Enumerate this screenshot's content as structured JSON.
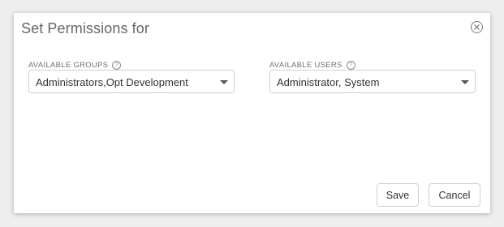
{
  "dialog": {
    "title": "Set Permissions for",
    "close_icon": "close-circle-icon"
  },
  "groups": {
    "label": "AVAILABLE GROUPS",
    "help_icon": "help-icon",
    "help_glyph": "?",
    "selected": "Administrators,Opt Development"
  },
  "users": {
    "label": "AVAILABLE USERS",
    "help_icon": "help-icon",
    "help_glyph": "?",
    "selected": "Administrator, System"
  },
  "footer": {
    "save_label": "Save",
    "cancel_label": "Cancel"
  }
}
